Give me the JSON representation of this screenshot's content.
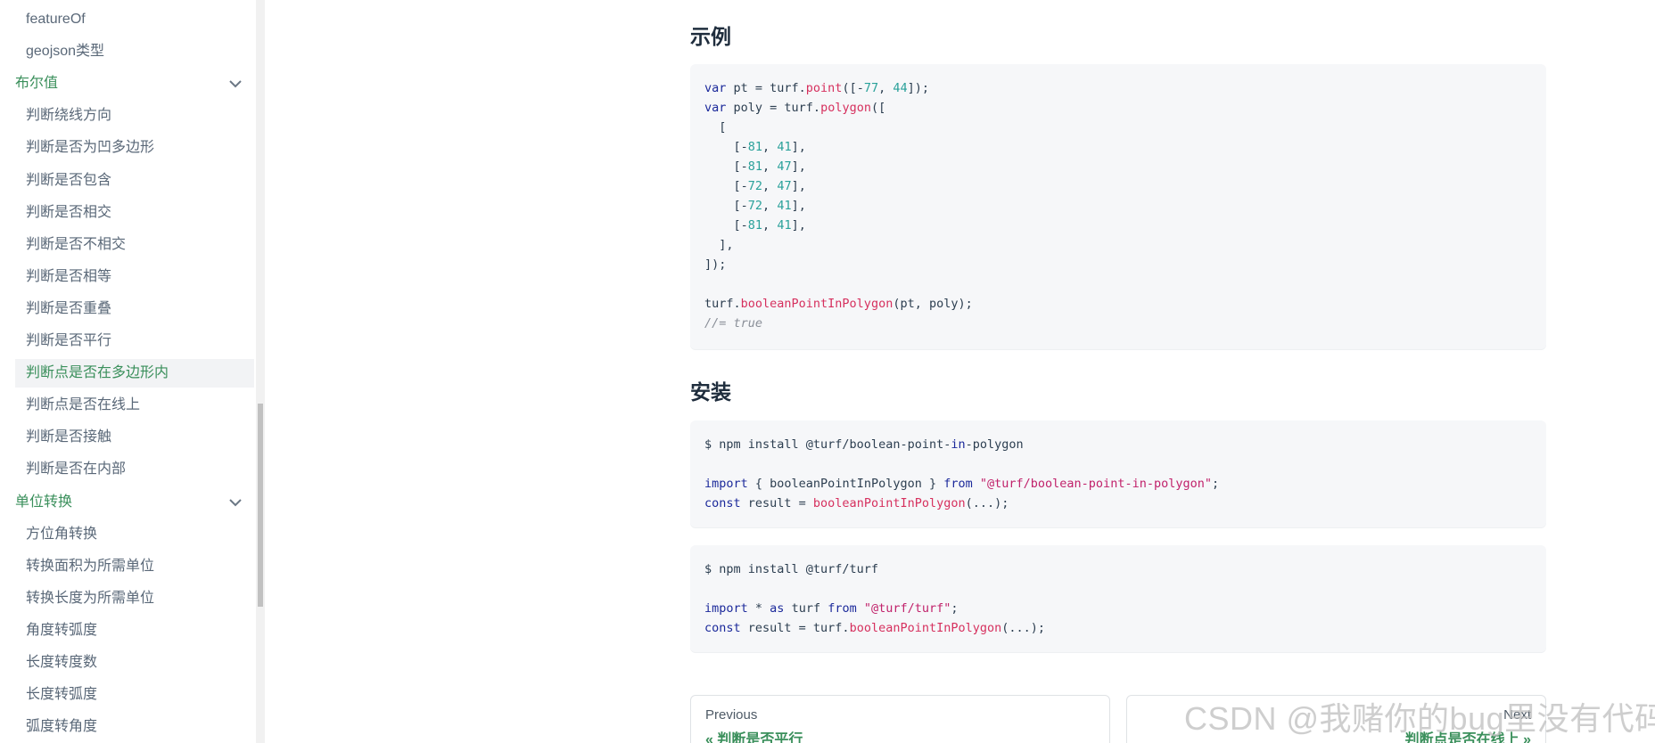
{
  "sidebar": {
    "items": [
      {
        "label": "featureOf",
        "type": "sub"
      },
      {
        "label": "geojson类型",
        "type": "sub"
      },
      {
        "label": "布尔值",
        "type": "group"
      },
      {
        "label": "判断绕线方向",
        "type": "sub"
      },
      {
        "label": "判断是否为凹多边形",
        "type": "sub"
      },
      {
        "label": "判断是否包含",
        "type": "sub"
      },
      {
        "label": "判断是否相交",
        "type": "sub"
      },
      {
        "label": "判断是否不相交",
        "type": "sub"
      },
      {
        "label": "判断是否相等",
        "type": "sub"
      },
      {
        "label": "判断是否重叠",
        "type": "sub"
      },
      {
        "label": "判断是否平行",
        "type": "sub"
      },
      {
        "label": "判断点是否在多边形内",
        "type": "active"
      },
      {
        "label": "判断点是否在线上",
        "type": "sub"
      },
      {
        "label": "判断是否接触",
        "type": "sub"
      },
      {
        "label": "判断是否在内部",
        "type": "sub"
      },
      {
        "label": "单位转换",
        "type": "group"
      },
      {
        "label": "方位角转换",
        "type": "sub"
      },
      {
        "label": "转换面积为所需单位",
        "type": "sub"
      },
      {
        "label": "转换长度为所需单位",
        "type": "sub"
      },
      {
        "label": "角度转弧度",
        "type": "sub"
      },
      {
        "label": "长度转度数",
        "type": "sub"
      },
      {
        "label": "长度转弧度",
        "type": "sub"
      },
      {
        "label": "弧度转角度",
        "type": "sub"
      }
    ]
  },
  "main": {
    "example_heading": "示例",
    "install_heading": "安装"
  },
  "pager": {
    "prev_label": "Previous",
    "prev_link": "« 判断是否平行",
    "next_label": "Next",
    "next_link": "判断点是否在线上 »"
  },
  "watermark": "CSDN @我赌你的bug里没有代码",
  "colors": {
    "accent": "#3a8f5b",
    "keyword": "#1c2a9b",
    "function": "#d6305e",
    "number": "#2aa19a",
    "string": "#c1226b",
    "comment": "#8a8f98",
    "code_bg": "#f6f7f9"
  }
}
